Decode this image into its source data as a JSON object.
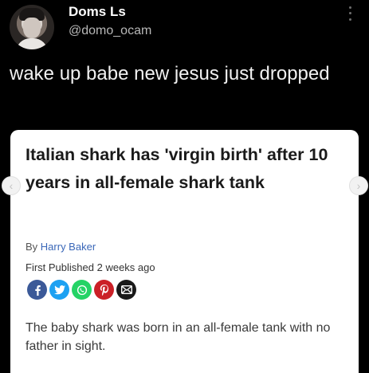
{
  "tweet": {
    "display_name": "Doms Ls",
    "handle": "@domo_ocam",
    "text": "wake up babe new jesus just dropped",
    "avatar_icon": "avatar-photo",
    "more_icon": "more-vertical-icon"
  },
  "card": {
    "headline": "Italian shark has 'virgin birth' after 10 years in all-female shark tank",
    "byline_prefix": "By ",
    "author": "Harry Baker",
    "published_label": "First Published",
    "published_value": "2 weeks ago",
    "summary": "The baby shark was born in an all-female tank with no father in sight.",
    "share_buttons": [
      {
        "name": "facebook",
        "glyph": "f",
        "color": "#3b5998"
      },
      {
        "name": "twitter",
        "glyph": "t",
        "color": "#1da1f2"
      },
      {
        "name": "whatsapp",
        "glyph": "w",
        "color": "#25d366"
      },
      {
        "name": "pinterest",
        "glyph": "P",
        "color": "#cb2027"
      },
      {
        "name": "email",
        "glyph": "✉",
        "color": "#1a1a1a"
      }
    ],
    "nav_prev_icon": "chevron-left-icon",
    "nav_next_icon": "chevron-right-icon"
  },
  "colors": {
    "background": "#000000",
    "card_background": "#ffffff",
    "author_link": "#3a67b8",
    "handle": "#b8b8b8"
  }
}
